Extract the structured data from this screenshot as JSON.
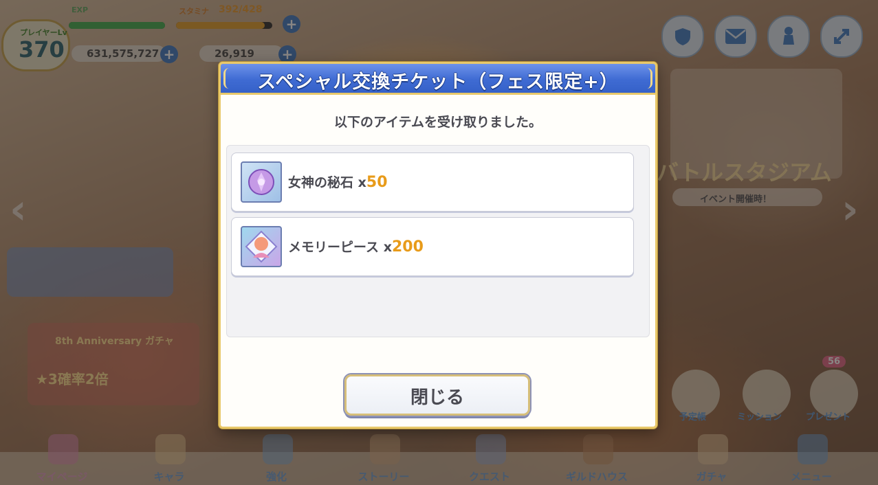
{
  "hud": {
    "level_label": "プレイヤーLv",
    "level": "370",
    "exp_label": "EXP",
    "stamina_label": "スタミナ",
    "stamina": "392/428",
    "mana": "631,575,727",
    "jewels": "26,919"
  },
  "dialog": {
    "title": "スペシャル交換チケット（フェス限定+）",
    "message": "以下のアイテムを受け取りました。",
    "items": [
      {
        "name": "女神の秘石",
        "qty_prefix": "x",
        "qty": "50",
        "icon": "goddess-stone-icon"
      },
      {
        "name": "メモリーピース",
        "qty_prefix": "x",
        "qty": "200",
        "icon": "memory-piece-icon"
      }
    ],
    "close_label": "閉じる"
  },
  "right_panel": {
    "event_title": "バトルスタジアム",
    "event_status": "イベント開催時！"
  },
  "banners": {
    "anniversary": "8th Anniversary ガチャ",
    "anniversary_sub": "★3確率2倍"
  },
  "right_menu": [
    "予定帳",
    "ミッション",
    "プレゼント"
  ],
  "present_badge": "56",
  "bottom_nav": [
    "マイページ",
    "キャラ",
    "強化",
    "ストーリー",
    "クエスト",
    "ギルドハウス",
    "ガチャ",
    "メニュー"
  ],
  "colors": {
    "header_blue": "#3f6bd3",
    "frame_gold": "#e8c86a",
    "qty_orange": "#e89b1a",
    "text_dark": "#4a4a52"
  }
}
